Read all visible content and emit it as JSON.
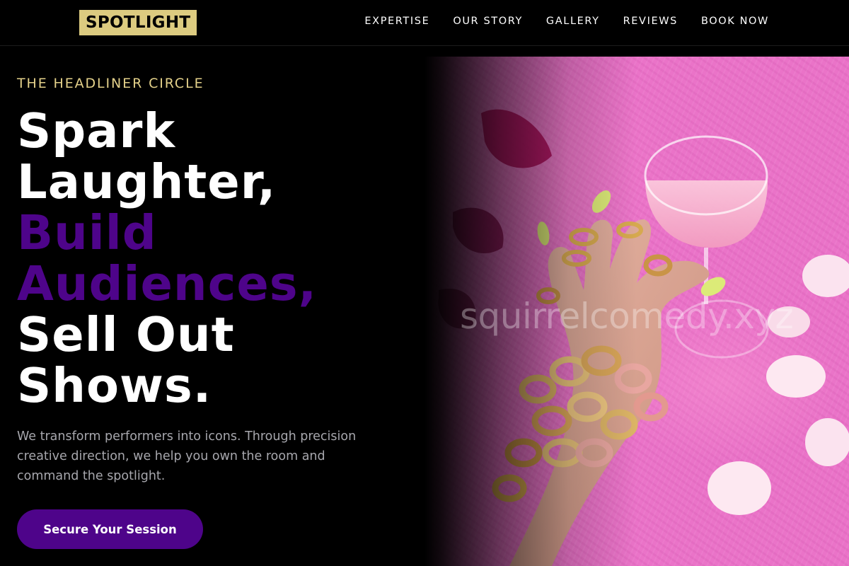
{
  "brand": {
    "logo_text": "SPOTLIGHT"
  },
  "nav": {
    "items": [
      {
        "label": "EXPERTISE"
      },
      {
        "label": "OUR STORY"
      },
      {
        "label": "GALLERY"
      },
      {
        "label": "REVIEWS"
      },
      {
        "label": "BOOK NOW"
      }
    ]
  },
  "hero": {
    "eyebrow": "THE HEADLINER CIRCLE",
    "headline": {
      "line1": "Spark",
      "line2": "Laughter,",
      "line3": "Build",
      "line4": "Audiences,",
      "line5": "Sell Out",
      "line6": "Shows."
    },
    "description": "We transform performers into icons. Through precision creative direction, we help you own the room and command the spotlight.",
    "cta_label": "Secure Your Session",
    "image_watermark": "squirrelcomedy.xyz"
  },
  "colors": {
    "background": "#000000",
    "logo_bg": "#dccb80",
    "eyebrow": "#e4d18a",
    "accent_purple": "#4e048a",
    "body_text": "#a7a7ad",
    "image_pink": "#ea73c8"
  }
}
